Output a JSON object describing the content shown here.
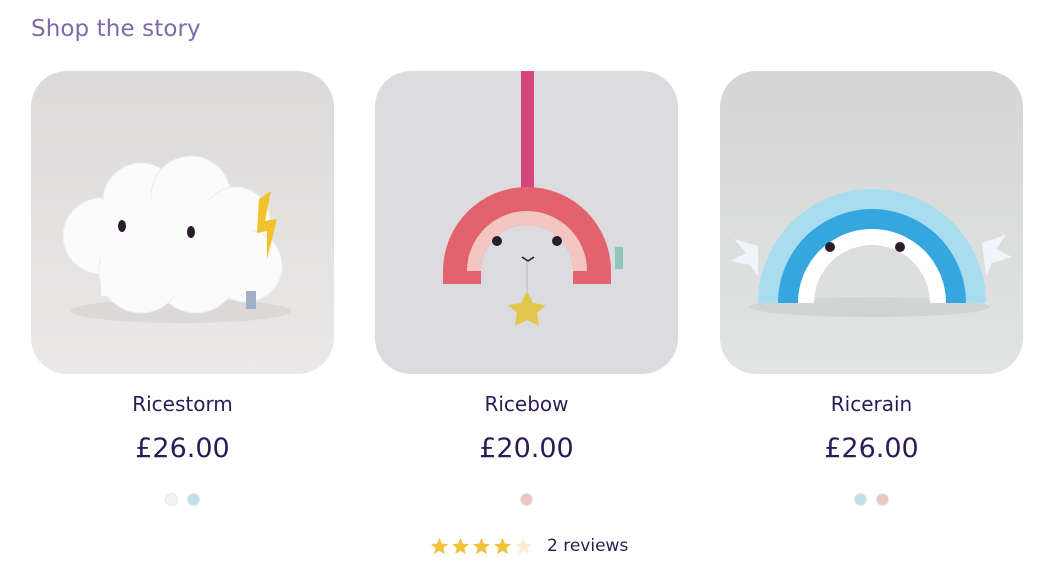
{
  "section": {
    "title": "Shop the story"
  },
  "products": [
    {
      "name": "Ricestorm",
      "price": "£26.00",
      "swatches": [
        "#f4f4f4",
        "#bfe0ea"
      ]
    },
    {
      "name": "Ricebow",
      "price": "£20.00",
      "swatches": [
        "#efc4c4"
      ]
    },
    {
      "name": "Ricerain",
      "price": "£26.00",
      "swatches": [
        "#bfe0ea",
        "#efc4c4"
      ]
    }
  ],
  "rating": {
    "value": 4,
    "max": 5,
    "count_label": "2 reviews"
  },
  "colors": {
    "title": "#7f6aa6",
    "text": "#2d1b55",
    "star_filled": "#f2c23a",
    "star_empty": "#fbeed0"
  }
}
